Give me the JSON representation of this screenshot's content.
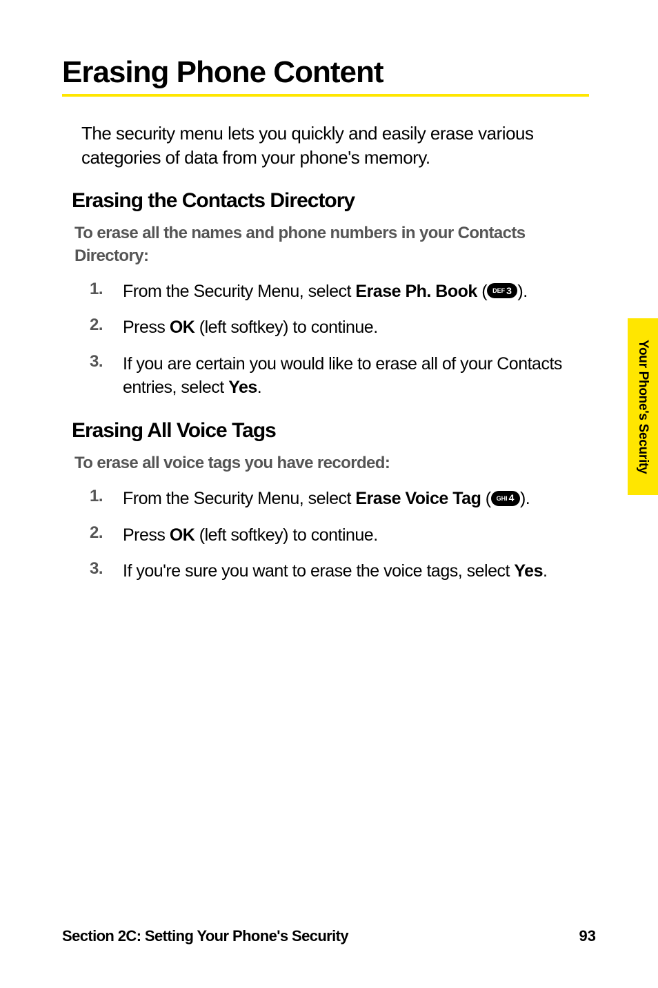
{
  "title": "Erasing Phone Content",
  "intro": "The security menu lets you quickly and easily erase various categories of data from your phone's memory.",
  "section1": {
    "heading": "Erasing the Contacts Directory",
    "lead": "To erase all the names and phone numbers in your Contacts Directory:",
    "steps": {
      "s1": {
        "num": "1.",
        "pre": "From the Security Menu, select ",
        "bold": "Erase Ph. Book",
        "post1": " (",
        "key_small": "DEF",
        "key_big": "3",
        "post2": ")."
      },
      "s2": {
        "num": "2.",
        "pre": "Press ",
        "bold": "OK",
        "post": " (left softkey) to continue."
      },
      "s3": {
        "num": "3.",
        "pre": "If you are certain you would like to erase all of your Contacts entries, select ",
        "bold": "Yes",
        "post": "."
      }
    }
  },
  "section2": {
    "heading": "Erasing All Voice Tags",
    "lead": "To erase all voice tags you have recorded:",
    "steps": {
      "s1": {
        "num": "1.",
        "pre": "From the Security Menu, select ",
        "bold": "Erase Voice Tag",
        "post1": " (",
        "key_small": "GHI",
        "key_big": "4",
        "post2": ")."
      },
      "s2": {
        "num": "2.",
        "pre": "Press ",
        "bold": "OK",
        "post": " (left softkey) to continue."
      },
      "s3": {
        "num": "3.",
        "pre": "If you're sure you want to erase the voice tags, select ",
        "bold": "Yes",
        "post": "."
      }
    }
  },
  "side_tab": "Your Phone's Security",
  "footer": {
    "left": "Section 2C: Setting Your Phone's Security",
    "right": "93"
  }
}
